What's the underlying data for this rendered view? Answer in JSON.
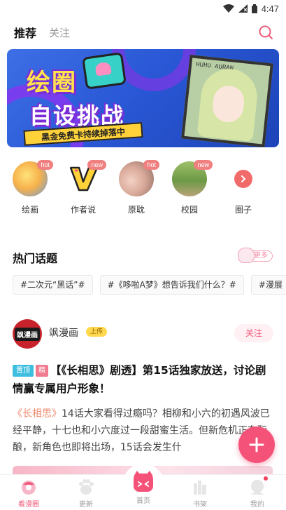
{
  "status_bar": {
    "time": "4:47"
  },
  "top_tabs": [
    {
      "label": "推荐",
      "active": true
    },
    {
      "label": "关注",
      "active": false
    }
  ],
  "banner": {
    "title_line1": "绘圈",
    "title_line2": "自设挑战",
    "strip_text": "黑金免费卡持续掉落中",
    "card_text": "HUHU AURAN"
  },
  "categories": [
    {
      "label": "绘画",
      "badge": "hot"
    },
    {
      "label": "作者说",
      "badge": "new"
    },
    {
      "label": "原耽",
      "badge": "hot"
    },
    {
      "label": "校园",
      "badge": "new"
    },
    {
      "label": "圈子",
      "badge": ""
    }
  ],
  "hot_topics": {
    "title": "热门话题",
    "more_label": "更多",
    "items": [
      "#二次元“黑话”#",
      "#《哆啦A梦》想告诉我们什么？#",
      "#漫展"
    ]
  },
  "post": {
    "author_name": "飒漫画",
    "author_badge": "上传",
    "avatar_text": "飒漫画",
    "follow_label": "关注",
    "tag_pin": "置顶",
    "tag_essence": "精",
    "title": "【《长相思》剧透】第15话独家放送，讨论剧情赢专属用户形象！",
    "body_link": "《长相思》",
    "body_text": "14话大家看得过瘾吗？相柳和小六的初遇风波已经平静，十七也和小六度过一段甜蜜生活。但新危机正在酝酿，新角色也即将出场，15话会发生什"
  },
  "bottom_nav": [
    {
      "label": "看漫圈",
      "active": true
    },
    {
      "label": "更新",
      "active": false
    },
    {
      "label": "首页",
      "active": false
    },
    {
      "label": "书架",
      "active": false
    },
    {
      "label": "我的",
      "active": false
    }
  ],
  "colors": {
    "accent": "#f05a7a",
    "fab": "#f5527a",
    "banner_blue": "#2a58d6",
    "badge": "#f08080"
  }
}
